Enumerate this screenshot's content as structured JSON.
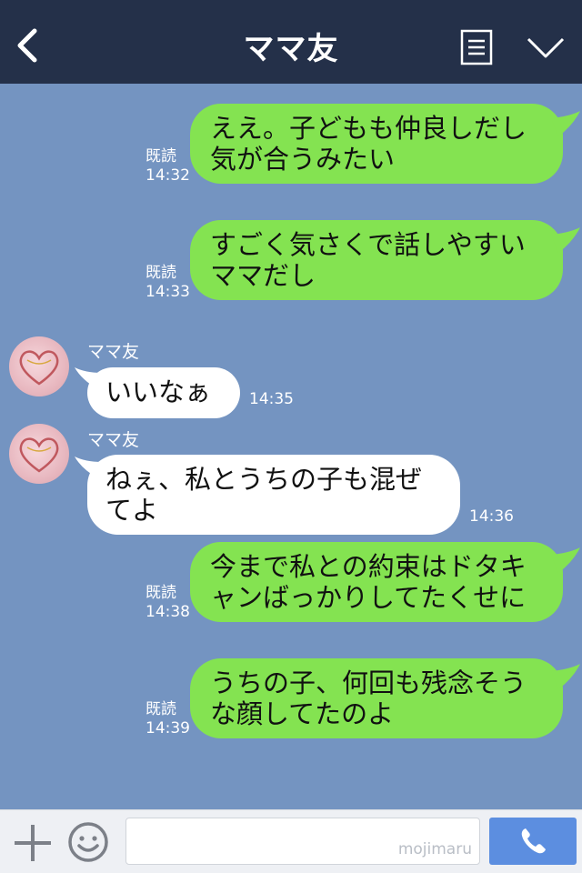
{
  "header": {
    "title": "ママ友",
    "back_icon": "chevron-left-icon",
    "menu_icon": "menu-list-icon",
    "collapse_icon": "chevron-down-icon"
  },
  "messages": [
    {
      "direction": "out",
      "lines": [
        "ええ。子どもも仲良しだし",
        "気が合うみたい"
      ],
      "read": "既読",
      "time": "14:32"
    },
    {
      "direction": "out",
      "lines": [
        "すごく気さくで話しやすい",
        "ママだし"
      ],
      "read": "既読",
      "time": "14:33"
    },
    {
      "direction": "in",
      "sender": "ママ友",
      "lines": [
        "いいなぁ"
      ],
      "time": "14:35"
    },
    {
      "direction": "in",
      "sender": "ママ友",
      "lines": [
        "ねぇ、私とうちの子も混ぜ",
        "てよ"
      ],
      "time": "14:36"
    },
    {
      "direction": "out",
      "lines": [
        "今まで私との約束はドタキ",
        "ャンばっかりしてたくせに"
      ],
      "read": "既読",
      "time": "14:38"
    },
    {
      "direction": "out",
      "lines": [
        "うちの子、何回も残念そう",
        "な顔してたのよ"
      ],
      "read": "既読",
      "time": "14:39"
    }
  ],
  "footer": {
    "watermark": "mojimaru",
    "input_value": ""
  },
  "colors": {
    "header_bg": "#243049",
    "chat_bg": "#7494c1",
    "outgoing_bubble": "#84e351",
    "incoming_bubble": "#ffffff",
    "call_button": "#5c8ee0"
  }
}
